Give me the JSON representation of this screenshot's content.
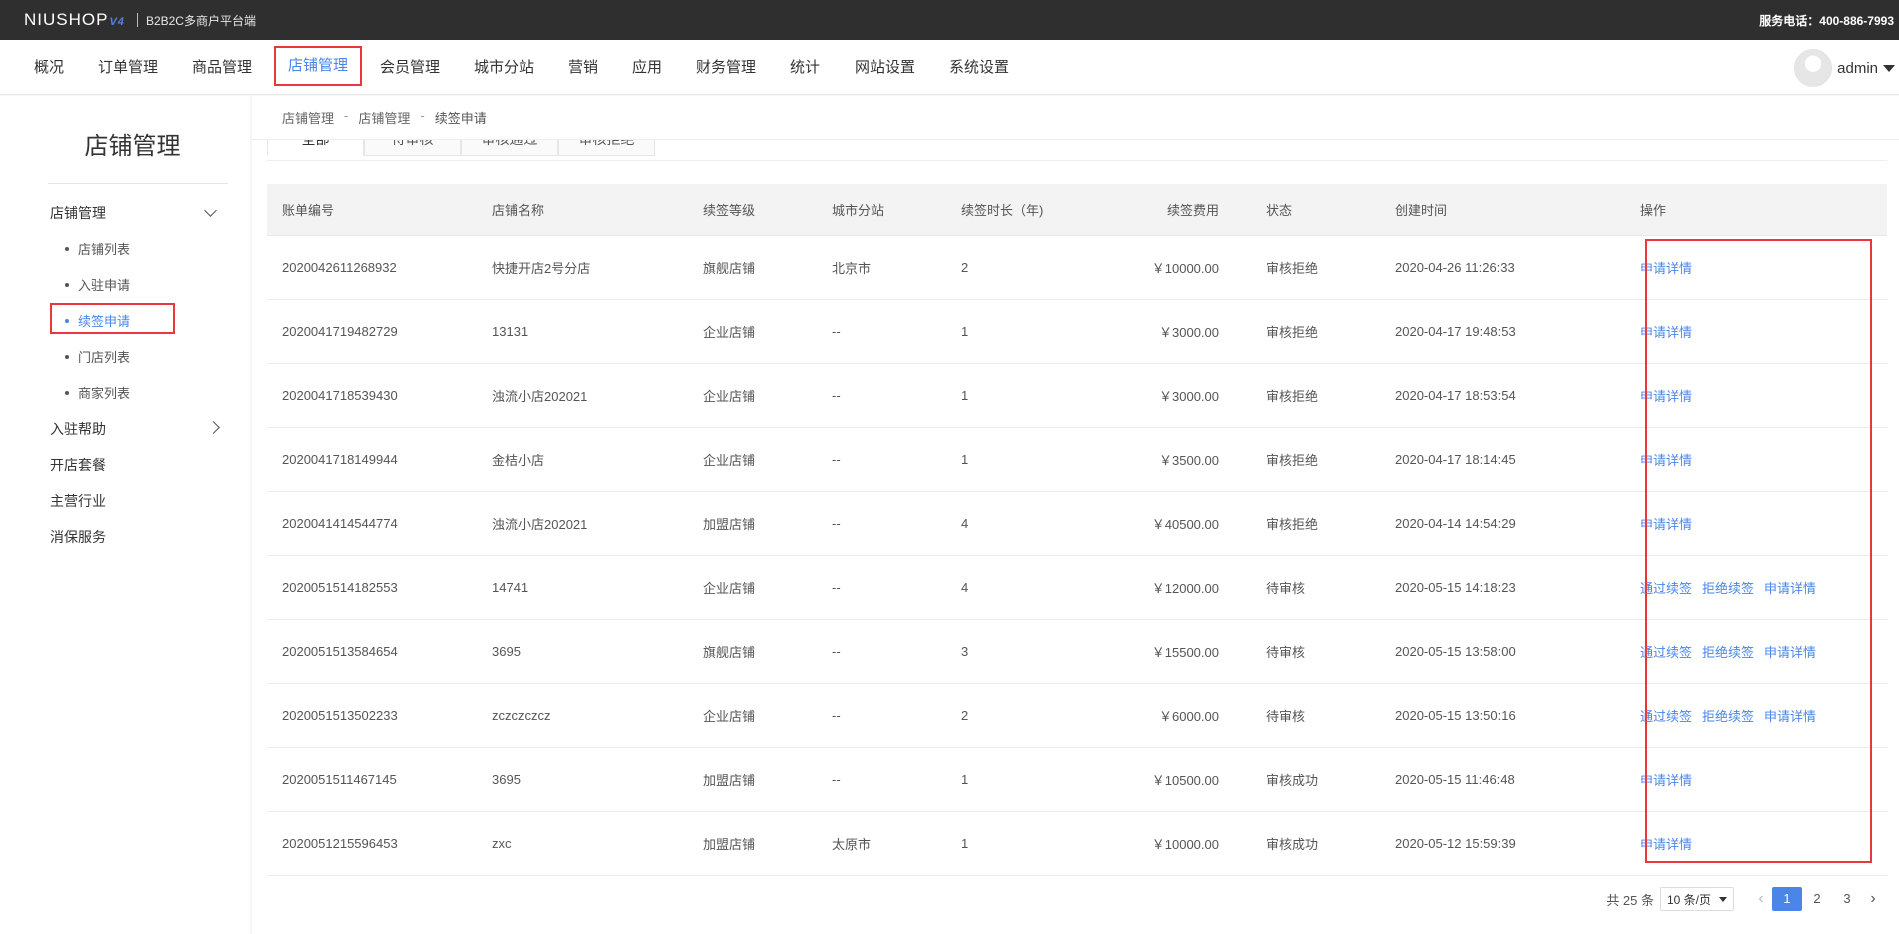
{
  "topbar": {
    "logo": "NIUSHOP",
    "logo_version": "V4",
    "subtitle": "B2B2C多商户平台端",
    "hotline": "服务电话：400-886-7993"
  },
  "nav": {
    "items": [
      "概况",
      "订单管理",
      "商品管理",
      "店铺管理",
      "会员管理",
      "城市分站",
      "营销",
      "应用",
      "财务管理",
      "统计",
      "网站设置",
      "系统设置"
    ],
    "active": "店铺管理",
    "user": "admin"
  },
  "sidebar": {
    "title": "店铺管理",
    "group1": "店铺管理",
    "subitems": [
      "店铺列表",
      "入驻申请",
      "续签申请",
      "门店列表",
      "商家列表"
    ],
    "active_sub": "续签申请",
    "group2": "入驻帮助",
    "group3": "开店套餐",
    "group4": "主营行业",
    "group5": "消保服务"
  },
  "breadcrumb": {
    "level1": "店铺管理",
    "level2": "店铺管理",
    "current": "续签申请",
    "sep": "-"
  },
  "tabs": [
    "全部",
    "待审核",
    "审核通过",
    "审核拒绝"
  ],
  "table": {
    "headers": [
      "账单编号",
      "店铺名称",
      "续签等级",
      "城市分站",
      "续签时长（年)",
      "续签费用",
      "状态",
      "创建时间",
      "操作"
    ],
    "rows": [
      {
        "bill_no": "2020042611268932",
        "shop": "快捷开店2号分店",
        "level": "旗舰店铺",
        "city": "北京市",
        "years": "2",
        "fee": "￥10000.00",
        "status": "审核拒绝",
        "created": "2020-04-26 11:26:33",
        "ops": [
          "申请详情"
        ]
      },
      {
        "bill_no": "2020041719482729",
        "shop": "13131",
        "level": "企业店铺",
        "city": "--",
        "years": "1",
        "fee": "￥3000.00",
        "status": "审核拒绝",
        "created": "2020-04-17 19:48:53",
        "ops": [
          "申请详情"
        ]
      },
      {
        "bill_no": "2020041718539430",
        "shop": "浊流小店202021",
        "level": "企业店铺",
        "city": "--",
        "years": "1",
        "fee": "￥3000.00",
        "status": "审核拒绝",
        "created": "2020-04-17 18:53:54",
        "ops": [
          "申请详情"
        ]
      },
      {
        "bill_no": "2020041718149944",
        "shop": "金桔小店",
        "level": "企业店铺",
        "city": "--",
        "years": "1",
        "fee": "￥3500.00",
        "status": "审核拒绝",
        "created": "2020-04-17 18:14:45",
        "ops": [
          "申请详情"
        ]
      },
      {
        "bill_no": "2020041414544774",
        "shop": "浊流小店202021",
        "level": "加盟店铺",
        "city": "--",
        "years": "4",
        "fee": "￥40500.00",
        "status": "审核拒绝",
        "created": "2020-04-14 14:54:29",
        "ops": [
          "申请详情"
        ]
      },
      {
        "bill_no": "2020051514182553",
        "shop": "14741",
        "level": "企业店铺",
        "city": "--",
        "years": "4",
        "fee": "￥12000.00",
        "status": "待审核",
        "created": "2020-05-15 14:18:23",
        "ops": [
          "通过续签",
          "拒绝续签",
          "申请详情"
        ]
      },
      {
        "bill_no": "2020051513584654",
        "shop": "3695",
        "level": "旗舰店铺",
        "city": "--",
        "years": "3",
        "fee": "￥15500.00",
        "status": "待审核",
        "created": "2020-05-15 13:58:00",
        "ops": [
          "通过续签",
          "拒绝续签",
          "申请详情"
        ]
      },
      {
        "bill_no": "2020051513502233",
        "shop": "zczczczcz",
        "level": "企业店铺",
        "city": "--",
        "years": "2",
        "fee": "￥6000.00",
        "status": "待审核",
        "created": "2020-05-15 13:50:16",
        "ops": [
          "通过续签",
          "拒绝续签",
          "申请详情"
        ]
      },
      {
        "bill_no": "2020051511467145",
        "shop": "3695",
        "level": "加盟店铺",
        "city": "--",
        "years": "1",
        "fee": "￥10500.00",
        "status": "审核成功",
        "created": "2020-05-15 11:46:48",
        "ops": [
          "申请详情"
        ]
      },
      {
        "bill_no": "2020051215596453",
        "shop": "zxc",
        "level": "加盟店铺",
        "city": "太原市",
        "years": "1",
        "fee": "￥10000.00",
        "status": "审核成功",
        "created": "2020-05-12 15:59:39",
        "ops": [
          "申请详情"
        ]
      }
    ]
  },
  "pagination": {
    "total": "共 25 条",
    "page_size": "10 条/页",
    "pages": [
      "1",
      "2",
      "3"
    ],
    "current": "1"
  },
  "colors": {
    "accent": "#4a86e8",
    "highlight_box": "#e8383d",
    "topbar": "#2f2f2f"
  }
}
